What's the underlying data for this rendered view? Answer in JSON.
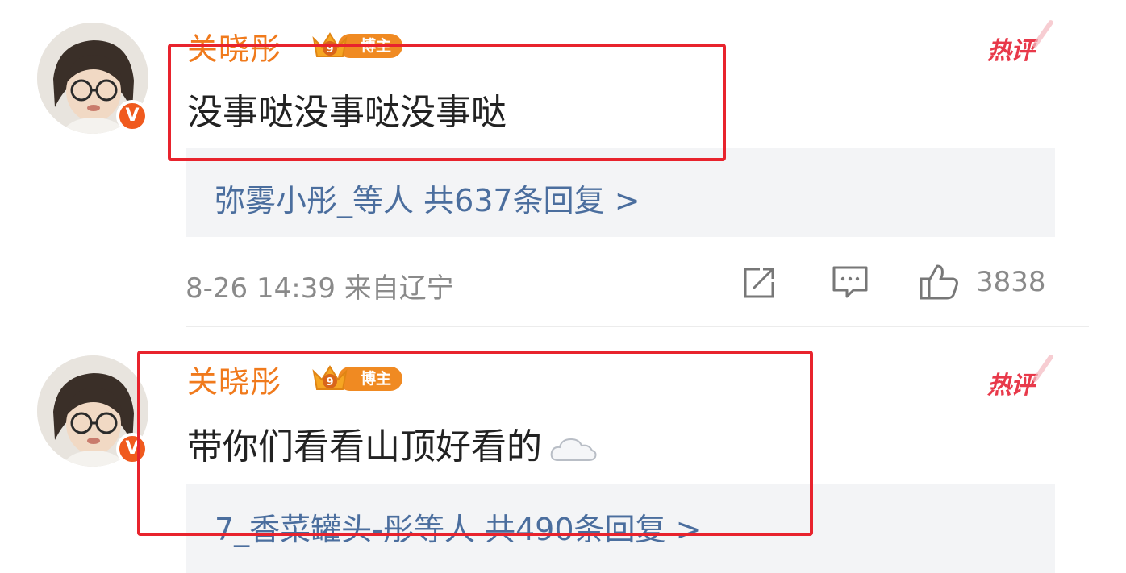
{
  "colors": {
    "username": "#f07a1c",
    "hot_tag": "#e8394a",
    "reply_link": "#4b6e9e",
    "highlight": "#e8232d",
    "meta": "#8a8a8a"
  },
  "comments": [
    {
      "username": "关晓彤",
      "vip_badge_label": "博主",
      "vip_level": "9",
      "verified_mark": "V",
      "hot_tag": "热评",
      "text": "没事哒没事哒没事哒",
      "reply_summary": "弥雾小彤_等人 共637条回复 >",
      "timestamp_location": "8-26 14:39 来自辽宁",
      "like_count": "3838",
      "icons": [
        "share-icon",
        "comment-icon",
        "like-icon"
      ]
    },
    {
      "username": "关晓彤",
      "vip_badge_label": "博主",
      "vip_level": "9",
      "verified_mark": "V",
      "hot_tag": "热评",
      "text": "带你们看看山顶好看的",
      "emoji": "cloud-icon",
      "reply_summary": "7_香菜罐头-彤等人 共490条回复 >"
    }
  ]
}
